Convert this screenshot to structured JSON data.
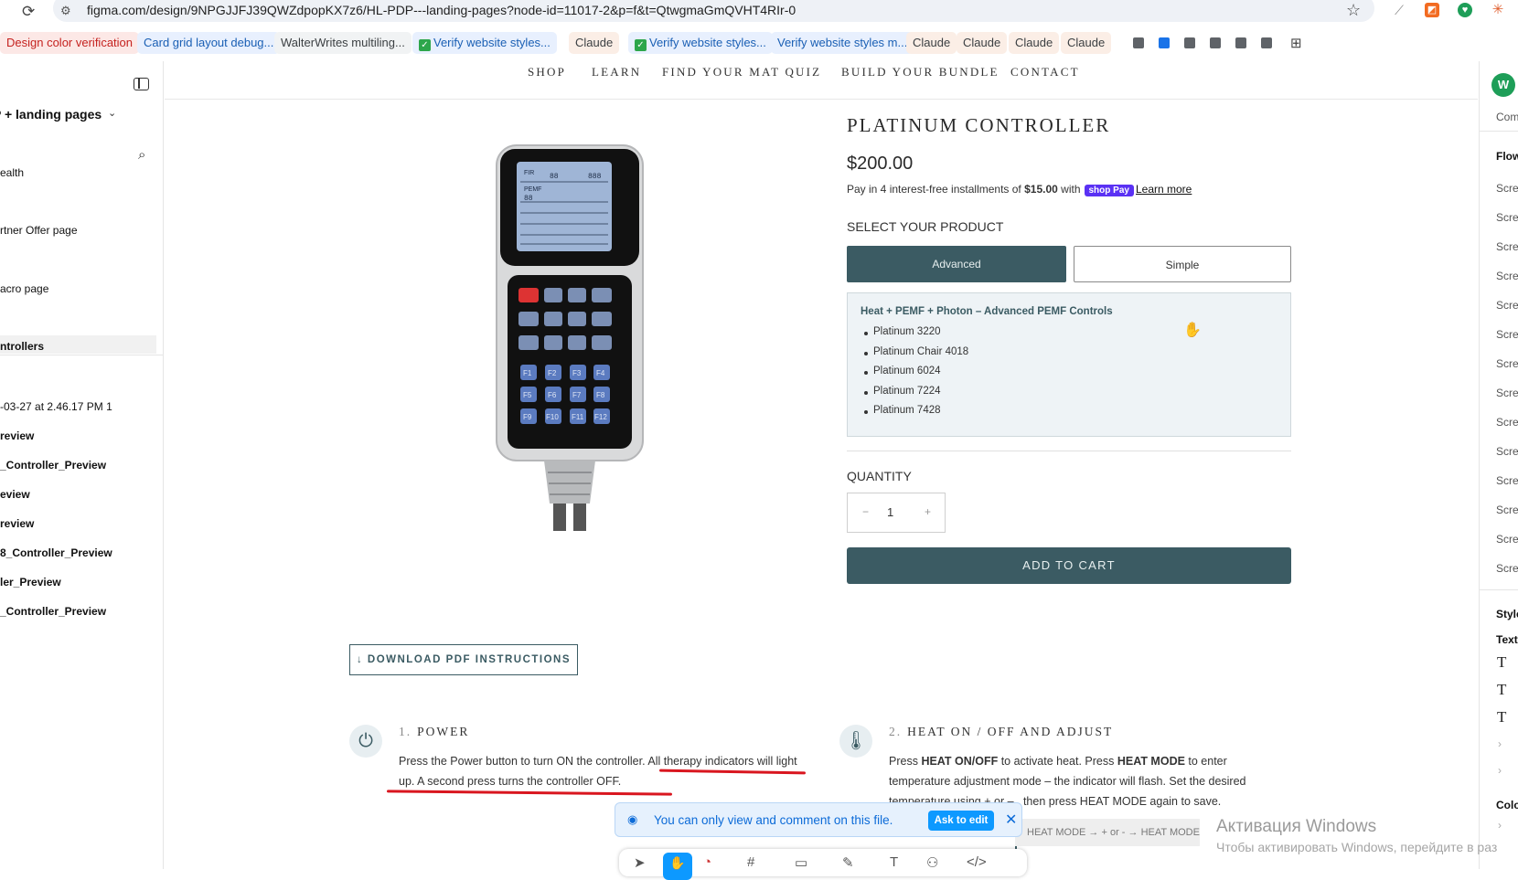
{
  "browser": {
    "url": "figma.com/design/9NPGJJFJ39QWZdpopKX7z6/HL-PDP---landing-pages?node-id=11017-2&p=f&t=QtwgmaGmQVHT4RIr-0",
    "bookmarks": [
      {
        "label": "Design color verification",
        "color": "#c5221f",
        "bg": "#fce8e6",
        "checked": false
      },
      {
        "label": "Card grid layout debug...",
        "color": "#1a5fb4",
        "bg": "#e8f0fe",
        "checked": false
      },
      {
        "label": "WalterWrites multiling...",
        "color": "#3c4043",
        "bg": "#f1f3f4",
        "checked": false
      },
      {
        "label": "Verify website styles...",
        "color": "#1a5fb4",
        "bg": "#e8f0fe",
        "checked": true
      },
      {
        "label": "Claude",
        "color": "#3c4043",
        "bg": "#fbeee6",
        "checked": false
      },
      {
        "label": "Verify website styles...",
        "color": "#1a5fb4",
        "bg": "#e8f0fe",
        "checked": true
      },
      {
        "label": "Verify website styles m...",
        "color": "#1a5fb4",
        "bg": "#e8f0fe",
        "checked": false
      },
      {
        "label": "Claude",
        "color": "#3c4043",
        "bg": "#fbeee6",
        "checked": false
      },
      {
        "label": "Claude",
        "color": "#3c4043",
        "bg": "#fbeee6",
        "checked": false
      },
      {
        "label": "Claude",
        "color": "#3c4043",
        "bg": "#fbeee6",
        "checked": false
      },
      {
        "label": "Claude",
        "color": "#3c4043",
        "bg": "#fbeee6",
        "checked": false
      }
    ]
  },
  "left_panel": {
    "page_title": "P + landing pages",
    "items": [
      {
        "label": "ealth",
        "bold": false
      },
      {
        "label": "rtner Offer page",
        "bold": false
      },
      {
        "label": "acro page",
        "bold": false
      },
      {
        "label": "ntrollers",
        "bold": true
      },
      {
        "label": "-03-27 at 2.46.17 PM 1",
        "bold": false
      },
      {
        "label": "review",
        "bold": true
      },
      {
        "label": "_Controller_Preview",
        "bold": true
      },
      {
        "label": "eview",
        "bold": true
      },
      {
        "label": "review",
        "bold": true
      },
      {
        "label": "8_Controller_Preview",
        "bold": true
      },
      {
        "label": "ler_Preview",
        "bold": true
      },
      {
        "label": "_Controller_Preview",
        "bold": true
      }
    ]
  },
  "right_panel": {
    "avatar": "W",
    "comment": "Com",
    "flows": "Flow",
    "screens": [
      "Scre",
      "Scre",
      "Scre",
      "Scre",
      "Scre",
      "Scre",
      "Scre",
      "Scre",
      "Scre",
      "Scre",
      "Scre",
      "Scre",
      "Scre",
      "Scre"
    ],
    "styles": "Style",
    "text": "Text",
    "colors": "Colo"
  },
  "design": {
    "nav": [
      "SHOP",
      "LEARN",
      "FIND YOUR MAT QUIZ",
      "BUILD YOUR BUNDLE",
      "CONTACT"
    ],
    "product_title": "PLATINUM CONTROLLER",
    "price": "$200.00",
    "installments_pre": "Pay in 4 interest-free installments of",
    "installments_amount": "$15.00",
    "installments_with": "with",
    "shop_pay": "shop Pay",
    "learn_more": "Learn more",
    "select_label": "SELECT YOUR PRODUCT",
    "options": [
      "Advanced",
      "Simple"
    ],
    "info_heading": "Heat + PEMF + Photon – Advanced PEMF Controls",
    "info_items": [
      "Platinum 3220",
      "Platinum Chair 4018",
      "Platinum 6024",
      "Platinum 7224",
      "Platinum 7428"
    ],
    "quantity_label": "QUANTITY",
    "quantity_value": "1",
    "minus": "−",
    "plus": "+",
    "add_to_cart": "ADD TO CART",
    "download_pdf": "↓ DOWNLOAD PDF INSTRUCTIONS",
    "steps": [
      {
        "num": "1.",
        "title": "POWER",
        "icon": "power-icon",
        "text_a": "Press the Power button to turn ON the controller. All therapy indicators will light up. A second press turns the controller OFF."
      },
      {
        "num": "2.",
        "title": "HEAT ON / OFF AND ADJUST",
        "icon": "thermometer-icon",
        "text_a": "Press ",
        "b1": "HEAT ON/OFF",
        "text_b": " to activate heat. Press ",
        "b2": "HEAT MODE",
        "text_c": " to enter temperature adjustment mode – the indicator will flash. Set the desired temperature using + or – , then press HEAT MODE again to save."
      }
    ],
    "code_hint": "HEAT MODE → + or - → HEAT MODE*",
    "accent_color": "#3b5b63"
  },
  "toast": {
    "message": "You can only view and comment on this file.",
    "button": "Ask to edit"
  },
  "watermark": {
    "line1": "Активация Windows",
    "line2": "Чтобы активировать Windows, перейдите в раз"
  }
}
